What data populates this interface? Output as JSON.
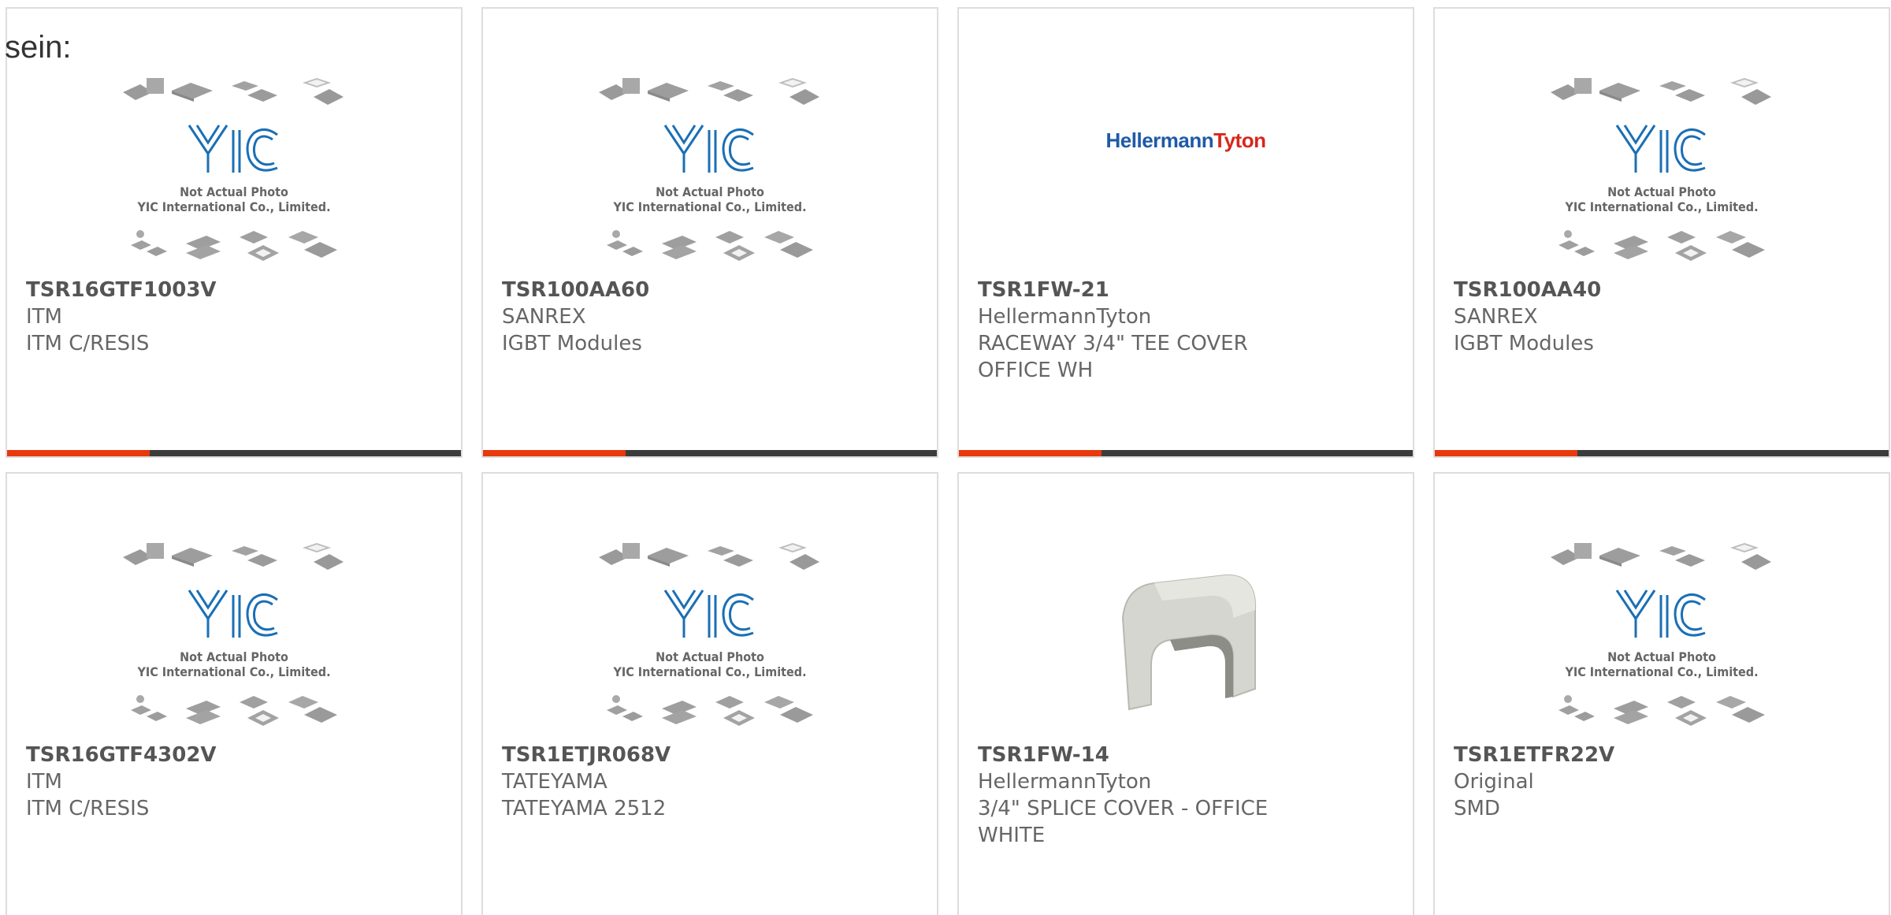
{
  "intro_text": "sein:",
  "placeholder_image": {
    "line1": "Not Actual Photo",
    "line2": "YIC International Co., Limited.",
    "logo_text": "YIC"
  },
  "brand_logo_text": {
    "part1": "Hellermann",
    "part2": "Tyton"
  },
  "products": [
    {
      "part_number": "TSR16GTF1003V",
      "manufacturer": "ITM",
      "description": "ITM C/RESIS",
      "description2": "",
      "image": "yic-placeholder"
    },
    {
      "part_number": "TSR100AA60",
      "manufacturer": "SANREX",
      "description": "IGBT Modules",
      "description2": "",
      "image": "yic-placeholder"
    },
    {
      "part_number": "TSR1FW-21",
      "manufacturer": "HellermannTyton",
      "description": "RACEWAY 3/4\" TEE COVER",
      "description2": "OFFICE WH",
      "image": "hellermanntyton-logo"
    },
    {
      "part_number": "TSR100AA40",
      "manufacturer": "SANREX",
      "description": "IGBT Modules",
      "description2": "",
      "image": "yic-placeholder"
    },
    {
      "part_number": "TSR16GTF4302V",
      "manufacturer": "ITM",
      "description": "ITM C/RESIS",
      "description2": "",
      "image": "yic-placeholder"
    },
    {
      "part_number": "TSR1ETJR068V",
      "manufacturer": "TATEYAMA",
      "description": "TATEYAMA 2512",
      "description2": "",
      "image": "yic-placeholder"
    },
    {
      "part_number": "TSR1FW-14",
      "manufacturer": "HellermannTyton",
      "description": "3/4\" SPLICE COVER - OFFICE",
      "description2": "WHITE",
      "image": "splice-cover-photo"
    },
    {
      "part_number": "TSR1ETFR22V",
      "manufacturer": "Original",
      "description": "SMD",
      "description2": "",
      "image": "yic-placeholder"
    }
  ],
  "colors": {
    "accent": "#e8380d",
    "bar_dark": "#3c3c3c",
    "text": "#666666",
    "yic_blue": "#1a6fb5",
    "hellermann_blue": "#1f5aa8",
    "tyton_red": "#d8261c"
  }
}
